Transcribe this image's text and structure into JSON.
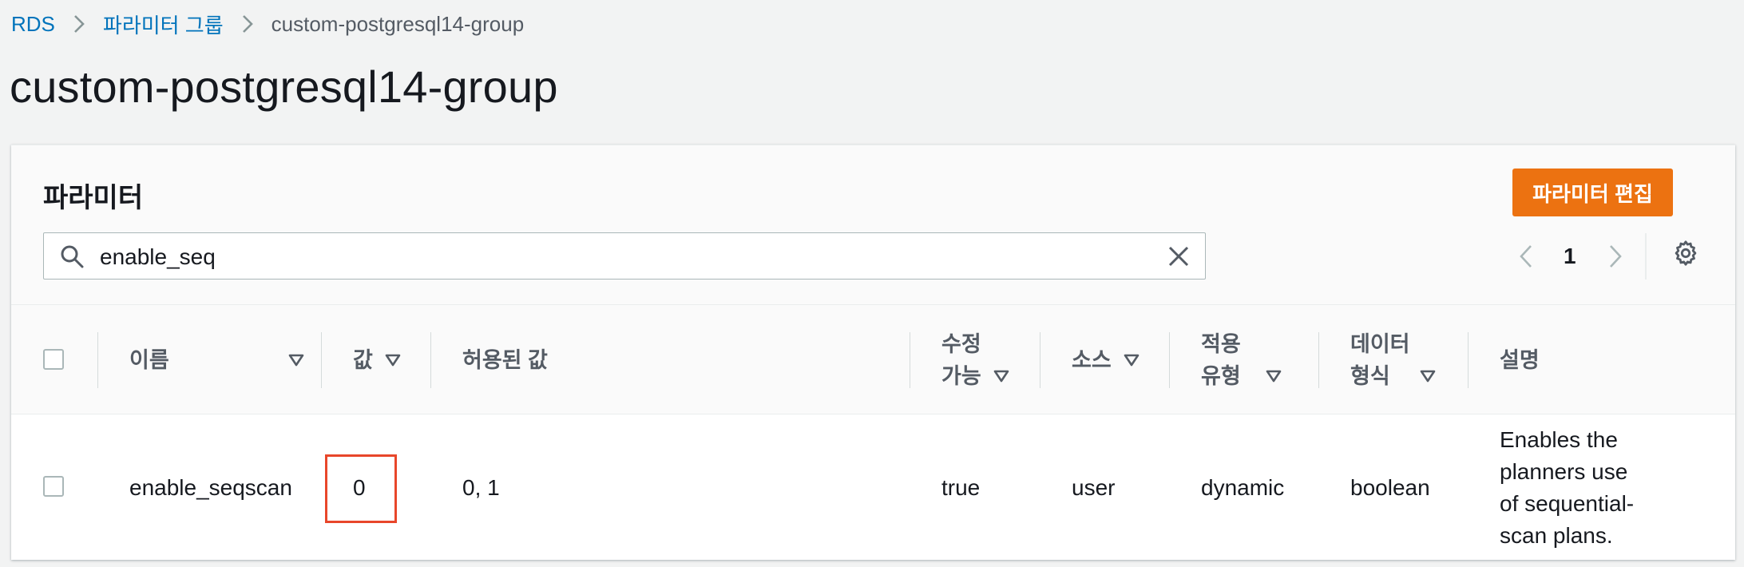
{
  "breadcrumb": {
    "items": [
      "RDS",
      "파라미터 그룹"
    ],
    "current": "custom-postgresql14-group"
  },
  "page": {
    "title": "custom-postgresql14-group"
  },
  "panel": {
    "title": "파라미터",
    "edit_button": "파라미터 편집",
    "search": {
      "value": "enable_seq"
    },
    "pagination": {
      "current_page": "1"
    }
  },
  "table": {
    "headers": {
      "name": "이름",
      "value": "값",
      "allowed": "허용된 값",
      "modifiable_1": "수정",
      "modifiable_2": "가능",
      "source": "소스",
      "apply_1": "적용",
      "apply_2": "유형",
      "datatype_1": "데이터",
      "datatype_2": "형식",
      "description": "설명"
    },
    "rows": [
      {
        "name": "enable_seqscan",
        "value": "0",
        "allowed": "0, 1",
        "modifiable": "true",
        "source": "user",
        "apply": "dynamic",
        "datatype": "boolean",
        "description": "Enables the planners use of sequential-scan plans."
      }
    ]
  },
  "colors": {
    "accent": "#ec7211",
    "link": "#0073bb",
    "highlight": "#e8462a"
  }
}
